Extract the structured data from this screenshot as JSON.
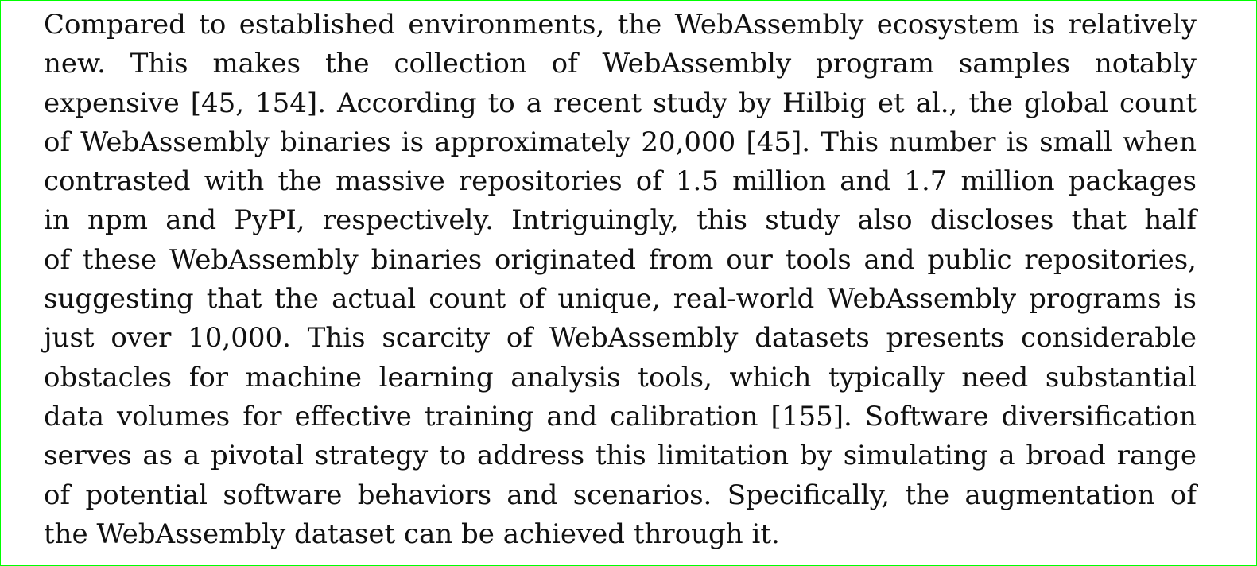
{
  "paragraph": {
    "lines": [
      "Compared to established environments, the WebAssembly ecosystem is relatively",
      "new. This makes the collection of WebAssembly program samples notably",
      "expensive [45, 154]. According to a recent study by Hilbig et al., the global count",
      "of WebAssembly binaries is approximately 20,000 [45]. This number is small when",
      "contrasted with the massive repositories of 1.5 million and 1.7 million packages",
      "in npm and PyPI, respectively. Intriguingly, this study also discloses that half",
      "of these WebAssembly binaries originated from our tools and public repositories,",
      "suggesting that the actual count of unique, real-world WebAssembly programs is",
      "just over 10,000. This scarcity of WebAssembly datasets presents considerable",
      "obstacles for machine learning analysis tools, which typically need substantial",
      "data volumes for effective training and calibration [155]. Software diversification",
      "serves as a pivotal strategy to address this limitation by simulating a broad range",
      "of potential software behaviors and scenarios. Specifically, the augmentation of",
      "the WebAssembly dataset can be achieved through it."
    ]
  }
}
